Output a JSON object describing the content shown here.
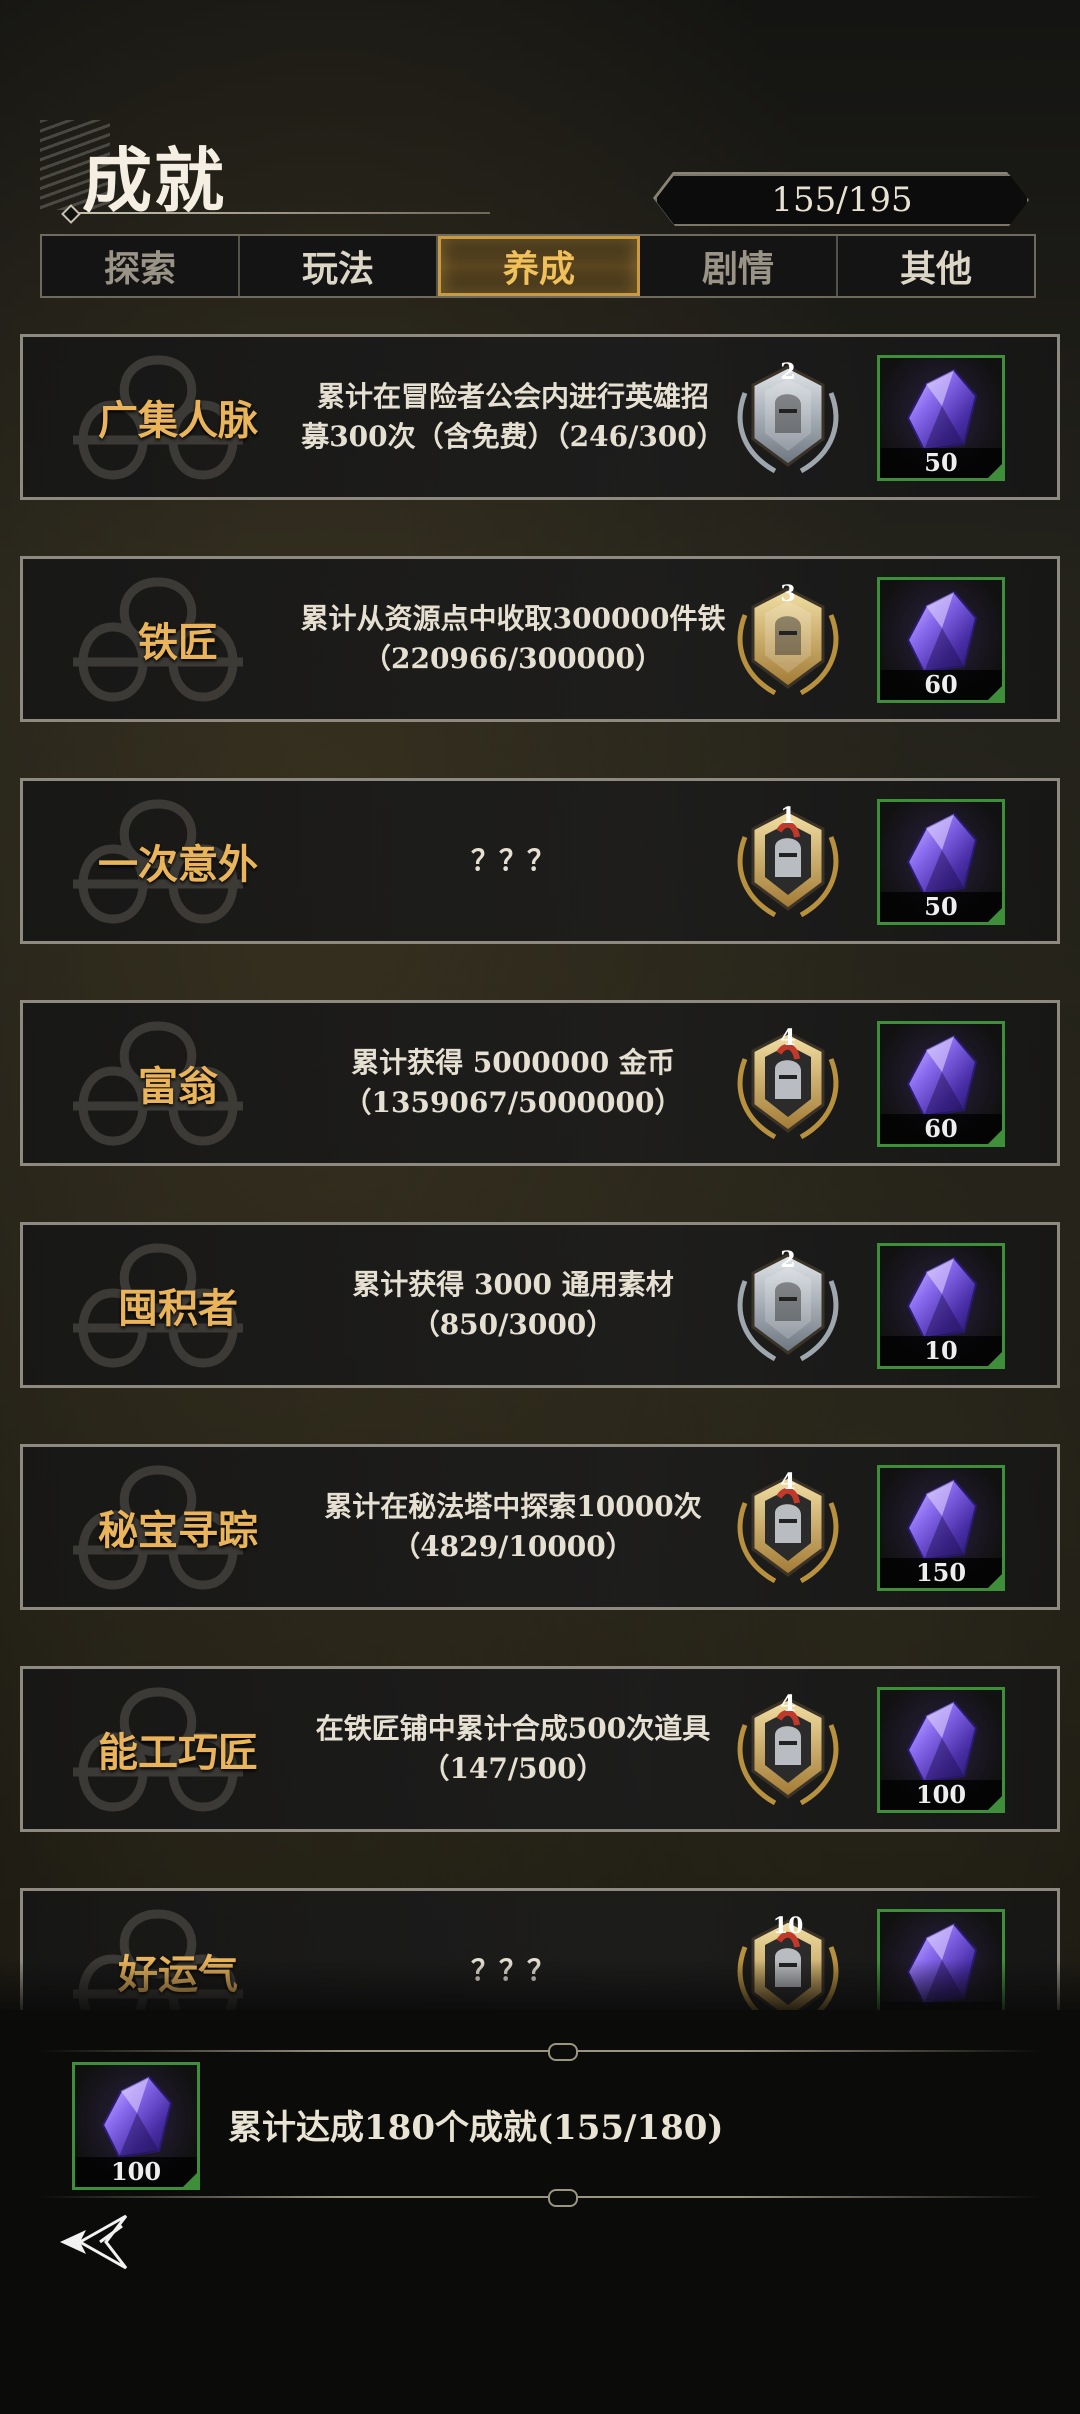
{
  "header": {
    "title": "成就",
    "progress": "155/195"
  },
  "tabs": [
    {
      "label": "探索",
      "state": "dim"
    },
    {
      "label": "玩法",
      "state": "normal"
    },
    {
      "label": "养成",
      "state": "active"
    },
    {
      "label": "剧情",
      "state": "dim"
    },
    {
      "label": "其他",
      "state": "normal"
    }
  ],
  "achievements": [
    {
      "name": "广集人脉",
      "desc_line1": "累计在冒险者公会内进行英雄招",
      "desc_line2": "募300次（含免费）（246/300）",
      "badge_level": "2",
      "badge_tier": "silver",
      "reward_count": "50"
    },
    {
      "name": "铁匠",
      "desc_line1": "累计从资源点中收取300000件铁",
      "desc_line2": "（220966/300000）",
      "badge_level": "3",
      "badge_tier": "gold",
      "reward_count": "60"
    },
    {
      "name": "一次意外",
      "desc_line1": "？？？",
      "desc_line2": "",
      "badge_level": "1",
      "badge_tier": "gold-knight",
      "reward_count": "50"
    },
    {
      "name": "富翁",
      "desc_line1": "累计获得 5000000 金币",
      "desc_line2": "（1359067/5000000）",
      "badge_level": "4",
      "badge_tier": "gold-knight",
      "reward_count": "60"
    },
    {
      "name": "囤积者",
      "desc_line1": "累计获得 3000 通用素材",
      "desc_line2": "（850/3000）",
      "badge_level": "2",
      "badge_tier": "silver",
      "reward_count": "10"
    },
    {
      "name": "秘宝寻踪",
      "desc_line1": "累计在秘法塔中探索10000次",
      "desc_line2": "（4829/10000）",
      "badge_level": "4",
      "badge_tier": "gold-knight",
      "reward_count": "150"
    },
    {
      "name": "能工巧匠",
      "desc_line1": "在铁匠铺中累计合成500次道具",
      "desc_line2": "（147/500）",
      "badge_level": "4",
      "badge_tier": "gold-knight",
      "reward_count": "100"
    },
    {
      "name": "好运气",
      "desc_line1": "？？？",
      "desc_line2": "",
      "badge_level": "10",
      "badge_tier": "gold-knight",
      "reward_count": ""
    }
  ],
  "total": {
    "text": "累计达成180个成就(155/180)",
    "reward_count": "100"
  },
  "colors": {
    "accent_gold": "#e9b45a",
    "active_tab": "#f0c15a",
    "reward_border": "#3f8f3a",
    "crystal": "#6a4fd0"
  },
  "icons": [
    "knot-emblem-icon",
    "rank-badge-icon",
    "purple-crystal-icon",
    "back-arrow-icon"
  ]
}
